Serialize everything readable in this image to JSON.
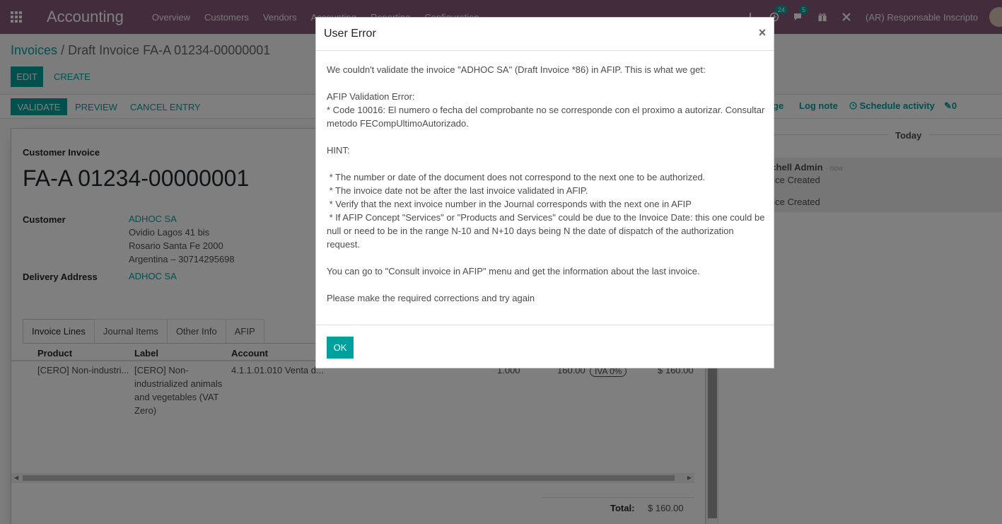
{
  "navbar": {
    "app_name": "Accounting",
    "menu": [
      "Overview",
      "Customers",
      "Vendors",
      "Accounting",
      "Reporting",
      "Configuration"
    ],
    "activity_count": "24",
    "message_count": "5",
    "company": "(AR) Responsable Inscripto"
  },
  "breadcrumb": {
    "parent": "Invoices",
    "separator": "/",
    "current": "Draft Invoice FA-A 01234-00000001"
  },
  "buttons": {
    "edit": "Edit",
    "create": "Create",
    "validate": "Validate",
    "preview": "Preview",
    "cancel_entry": "Cancel Entry"
  },
  "form": {
    "doc_type": "Customer Invoice",
    "number": "FA-A 01234-00000001",
    "customer_label": "Customer",
    "customer_name": "ADHOC SA",
    "address_line1": "Ovidio Lagos 41 bis",
    "address_line2": "Rosario Santa Fe 2000",
    "address_line3": "Argentina – 30714295698",
    "delivery_label": "Delivery Address",
    "delivery_value": "ADHOC SA",
    "tabs": [
      "Invoice Lines",
      "Journal Items",
      "Other Info",
      "AFIP"
    ],
    "columns": {
      "product": "Product",
      "label": "Label",
      "account": "Account"
    },
    "line": {
      "product": "[CERO] Non-industri...",
      "label_1": "[CERO] Non-",
      "label_2": "industrialized animals",
      "label_3": "and vegetables (VAT",
      "label_4": "Zero)",
      "account": "4.1.1.01.010 Venta d...",
      "quantity": "1.000",
      "price": "160.00",
      "tax": "IVA 0%",
      "subtotal": "$ 160.00"
    },
    "total_label": "Total:",
    "total_value": "$ 160.00"
  },
  "chatter": {
    "send_message_fragment": "ge",
    "log_note": "Log note",
    "schedule_activity": "Schedule activity",
    "attachments": "0",
    "today": "Today",
    "author": "tchell Admin",
    "time": "- now",
    "msg1": "oice Created",
    "msg2": "oice Created"
  },
  "modal": {
    "title": "User Error",
    "close": "×",
    "body_lines": [
      "We couldn't validate the invoice \"ADHOC SA\" (Draft Invoice *86) in AFIP. This is what we get:",
      "",
      "AFIP Validation Error:",
      "* Code 10016: El numero o fecha del comprobante no se corresponde con el proximo a autorizar. Consultar metodo FECompUltimoAutorizado.",
      "",
      "HINT:",
      "",
      " * The number or date of the document does not correspond to the next one to be authorized.",
      " * The invoice date not be after the last invoice validated in AFIP.",
      " * Verify that the next invoice number in the Journal corresponds with the next one in AFIP",
      " * If AFIP Concept \"Services\" or \"Products and Services\" could be due to the Invoice Date: this one could be null or need to be in the range N-10 and N+10 days being N the date of dispatch of the authorization request.",
      "",
      "You can go to \"Consult invoice in AFIP\" menu and get the information about the last invoice.",
      "",
      "Please make the required corrections and try again"
    ],
    "ok": "OK"
  },
  "colors": {
    "navbar": "#875a7b",
    "accent": "#00a09d"
  }
}
